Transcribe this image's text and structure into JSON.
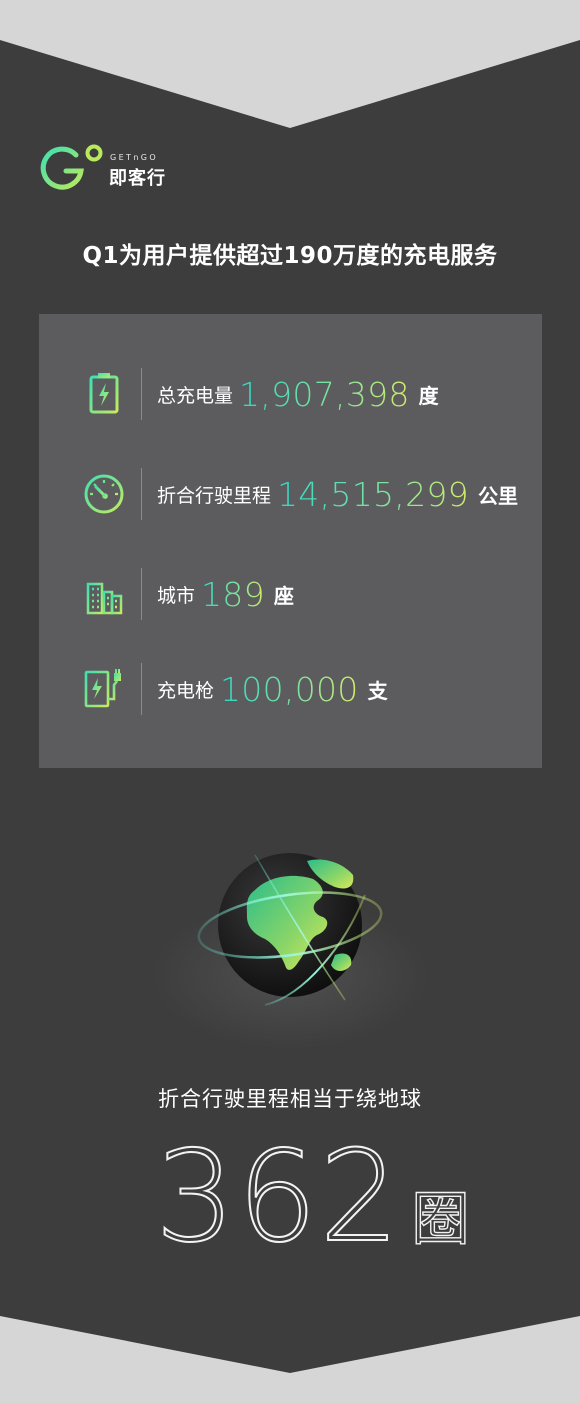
{
  "brand": {
    "logo_text_en": "GETnGO",
    "logo_text_cn": "即客行",
    "logo_colors": [
      "#3fe0b0",
      "#b9ea5e"
    ]
  },
  "headline": "Q1为用户提供超过190万度的充电服务",
  "stats": [
    {
      "icon": "battery-icon",
      "label": "总充电量",
      "value": "1,907,398",
      "unit": "度"
    },
    {
      "icon": "speedometer-icon",
      "label": "折合行驶里程",
      "value": "14,515,299",
      "unit": "公里"
    },
    {
      "icon": "city-buildings-icon",
      "label": "城市",
      "value": "189",
      "unit": "座"
    },
    {
      "icon": "charging-station-icon",
      "label": "充电枪",
      "value": "100,000",
      "unit": "支"
    }
  ],
  "equivalence": {
    "caption": "折合行驶里程相当于绕地球",
    "laps": "362",
    "unit": "圈"
  },
  "colors": {
    "background": "#3d3d3d",
    "panel": "#5c5c5e",
    "accent_start": "#33d6c6",
    "accent_end": "#d2ec6a"
  }
}
